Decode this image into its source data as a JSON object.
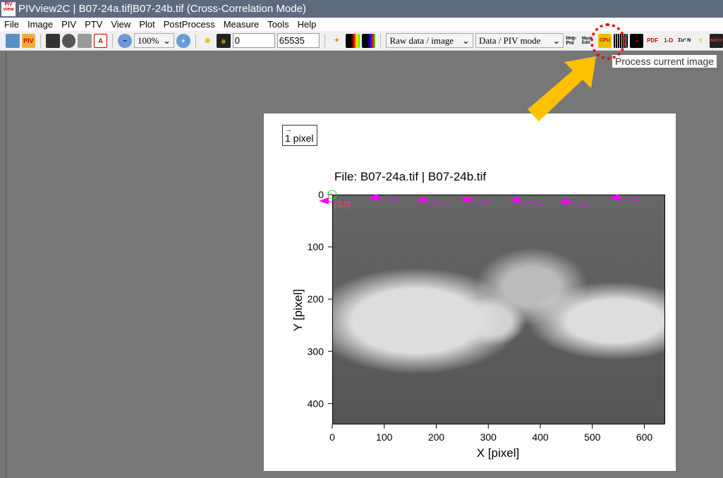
{
  "window": {
    "title": "PIVview2C | B07-24a.tif|B07-24b.tif (Cross-Correlation Mode)"
  },
  "menu": [
    "File",
    "Image",
    "PIV",
    "PTV",
    "View",
    "Plot",
    "PostProcess",
    "Measure",
    "Tools",
    "Help"
  ],
  "toolbar": {
    "zoom": "100%",
    "min_value": "0",
    "max_value": "65535",
    "display_mode": "Raw data / image",
    "data_mode": "Data / PIV mode",
    "icons": [
      "open-icon",
      "open-piv-icon",
      "save-icon",
      "record-icon",
      "print-icon",
      "pdf-icon",
      "zoom-out-icon",
      "zoom-in-icon",
      "bulb-icon",
      "dark-bulb-icon",
      "wand-icon",
      "colormap-icon",
      "colormap-add-icon",
      "img-pre-icon",
      "mask-edit-icon",
      "cpu-icon",
      "process-current-image-icon",
      "outlier-icon",
      "pdf-chart-icon",
      "1d-chart-icon",
      "statistics-icon",
      "help-vectors-icon",
      "batch-piv-icon"
    ],
    "labels": {
      "img_pre": "Img-Pre",
      "mask": "Mask Edit",
      "cpu": "CPU",
      "pdf": "PDF",
      "oned": "1-D",
      "stat": "Σu² N",
      "batch": "BATCH"
    }
  },
  "tooltip": "Process current image",
  "highlight_color": "#ff0000",
  "arrow_color": "#ffc000",
  "vector_color": "#ff00ff",
  "plot": {
    "legend": "1 pixel",
    "title": "File: B07-24a.tif | B07-24b.tif",
    "origin_label": "[0,0]",
    "xlabel": "X [pixel]",
    "ylabel": "Y [pixel]",
    "xticks": [
      "0",
      "100",
      "200",
      "300",
      "400",
      "500",
      "600"
    ],
    "yticks": [
      "0",
      "100",
      "200",
      "300",
      "400"
    ],
    "xlim": [
      0,
      640
    ],
    "ylim": [
      0,
      440
    ]
  }
}
